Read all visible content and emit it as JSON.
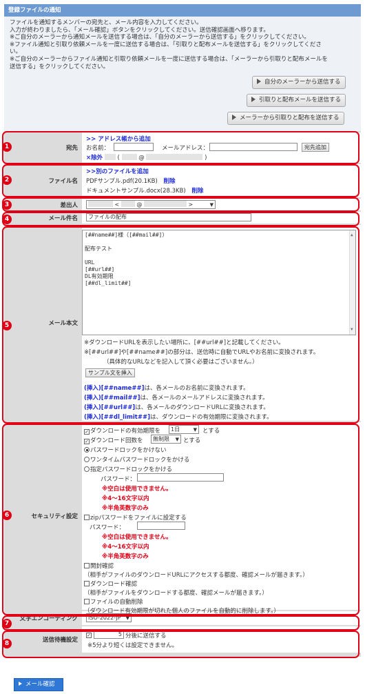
{
  "panel": {
    "title": "登録ファイルの通知"
  },
  "intro": {
    "lines": [
      "ファイルを通知するメンバーの宛先と、メール内容を入力してください。",
      "入力が終わりましたら、「メール確認」ボタンをクリックしてください。送信確認画面へ移ります。",
      "※ご自分のメーラーから通知メールを送信する場合は、「自分のメーラーから送信する」をクリックしてください。",
      "※ファイル通知と引取り依頼メールを一度に送信する場合は、「引取りと配布メールを送信する」をクリックしてくださ",
      "い。",
      "※ご自分のメーラーからファイル通知と引取り依頼メールを一度に送信する場合は、「メーラーから引取りと配布メールを",
      "送信する」をクリックしてください。"
    ]
  },
  "actions": {
    "own_mailer": "自分のメーラーから送信する",
    "pickup_send": "引取りと配布メールを送信する",
    "mailer_pickup": "メーラーから引取りと配布を送信する"
  },
  "markers": [
    "1",
    "2",
    "3",
    "4",
    "5",
    "6",
    "7",
    "8"
  ],
  "recipient": {
    "label": "宛先",
    "address_book_link": ">> アドレス帳から追加",
    "name_label": "お名前：",
    "email_label": "メールアドレス：",
    "add_button": "宛先追加",
    "remove_prefix": "×除外",
    "entry_suffix": "@",
    "paren_open": "(",
    "paren_close": ")"
  },
  "files": {
    "label": "ファイル名",
    "add_link": ">>別のファイルを追加",
    "items": [
      {
        "name": "PDFサンプル.pdf(20.1KB)",
        "delete": "削除"
      },
      {
        "name": "ドキュメントサンプル.docx(28.3KB)",
        "delete": "削除"
      }
    ]
  },
  "sender": {
    "label": "差出人",
    "lt": "<",
    "at": "@",
    "gt": ">"
  },
  "subject": {
    "label": "メール件名",
    "value": "ファイルの配布"
  },
  "body": {
    "label": "メール本文",
    "lines": [
      "[##name##]様（[##mail##]）",
      "",
      "配布テスト",
      "",
      "URL",
      "[##url##]",
      "DL有効期限",
      "[##dl_limit##]"
    ],
    "note1": "※ダウンロードURLを表示したい場所に、[##url##]と記載してください。",
    "note2": "※[##url##]や[##name##]の部分は、送信時に自動でURLやお名前に変換されます。",
    "note3": "（具体的なURLなどを記入して頂く必要はございません。）",
    "sample_button": "サンプル文を挿入",
    "inserts": [
      {
        "tag": "(挿入)",
        "code": "[##name##]",
        "desc": "は、各メールのお名前に変換されます。"
      },
      {
        "tag": "(挿入)",
        "code": "[##mail##]",
        "desc": "は、各メールのメールアドレスに変換されます。"
      },
      {
        "tag": "(挿入)",
        "code": "[##url##]",
        "desc": "は、各メールのダウンロードURLに変換されます。"
      },
      {
        "tag": "(挿入)",
        "code": "[##dl_limit##]",
        "desc": "は、ダウンロードの有効期限に変換されます。"
      }
    ]
  },
  "security": {
    "label": "セキュリティ設定",
    "expiry_pre": "ダウンロードの有効期限を",
    "expiry_value": "1日",
    "expiry_post": "とする",
    "count_pre": "ダウンロード回数を",
    "count_value": "無制限",
    "count_post": "とする",
    "radio_none": "パスワードロックをかけない",
    "radio_onetime": "ワンタイムパスワードロックをかける",
    "radio_custom": "指定パスワードロックをかける",
    "password_label": "パスワード：",
    "warn_space": "※空白は使用できません。",
    "warn_length": "※4～16文字以内",
    "warn_chars": "※半角英数字のみ",
    "zip_label": "zipパスワードをファイルに設定する",
    "open_confirm": "開封確認",
    "open_confirm_note": "（相手がファイルのダウンロードURLにアクセスする都度、確認メールが届きます。）",
    "dl_confirm": "ダウンロード確認",
    "dl_confirm_note": "（相手がファイルをダウンロードする都度、確認メールが届きます。）",
    "auto_delete": "ファイルの自動削除",
    "auto_delete_note": "（ダウンロード有効期限が切れた個人のファイルを自動的に削除します。）"
  },
  "encoding": {
    "label": "文字エンコーディング",
    "value": "ISO-2022-JP"
  },
  "delay": {
    "label": "送信待機設定",
    "value": "5",
    "suffix": "分後に送信する",
    "note": "※5分より短くは設定できません。"
  },
  "submit": {
    "label": "メール確認"
  },
  "colors": {
    "accent": "#6d9ad0",
    "marker": "#e00016",
    "link": "#1d2ad6",
    "submit": "#2f78d6"
  }
}
